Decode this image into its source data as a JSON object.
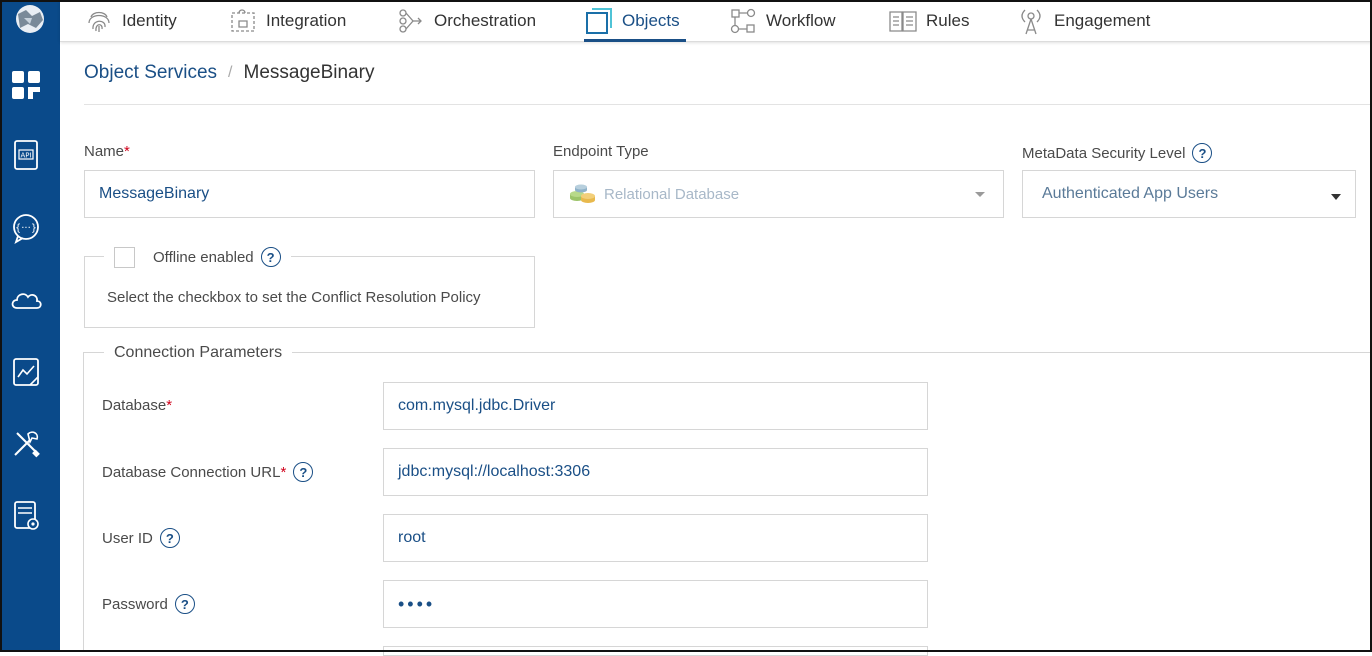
{
  "colors": {
    "rail": "#0a4a8a",
    "accent": "#1a4f86",
    "required": "#d0021b"
  },
  "rail": {
    "icons": [
      "app-logo-icon",
      "dashboard-grid-icon",
      "api-icon",
      "chat-bubble-icon",
      "cloud-icon",
      "analytics-chart-icon",
      "tools-icon",
      "server-config-icon"
    ]
  },
  "nav": {
    "tabs": [
      {
        "label": "Identity",
        "icon": "fingerprint-icon"
      },
      {
        "label": "Integration",
        "icon": "puzzle-icon"
      },
      {
        "label": "Orchestration",
        "icon": "orchestration-icon"
      },
      {
        "label": "Objects",
        "icon": "objects-icon",
        "active": true
      },
      {
        "label": "Workflow",
        "icon": "workflow-icon"
      },
      {
        "label": "Rules",
        "icon": "rules-book-icon"
      },
      {
        "label": "Engagement",
        "icon": "engagement-antenna-icon"
      }
    ]
  },
  "breadcrumb": {
    "parent": "Object Services",
    "separator": "/",
    "current": "MessageBinary"
  },
  "form": {
    "name": {
      "label": "Name",
      "required_mark": "*",
      "value": "MessageBinary"
    },
    "endpoint": {
      "label": "Endpoint Type",
      "value": "Relational Database"
    },
    "security": {
      "label": "MetaData Security Level",
      "value": "Authenticated App Users"
    },
    "offline": {
      "label": "Offline enabled",
      "hint": "Select the checkbox to set the Conflict Resolution Policy"
    },
    "connection": {
      "title": "Connection Parameters",
      "database": {
        "label": "Database",
        "required_mark": "*",
        "value": "com.mysql.jdbc.Driver"
      },
      "url": {
        "label": "Database Connection URL",
        "required_mark": "*",
        "value": "jdbc:mysql://localhost:3306"
      },
      "user": {
        "label": "User ID",
        "value": "root"
      },
      "password": {
        "label": "Password",
        "value": "••••"
      }
    },
    "help_glyph": "?"
  }
}
